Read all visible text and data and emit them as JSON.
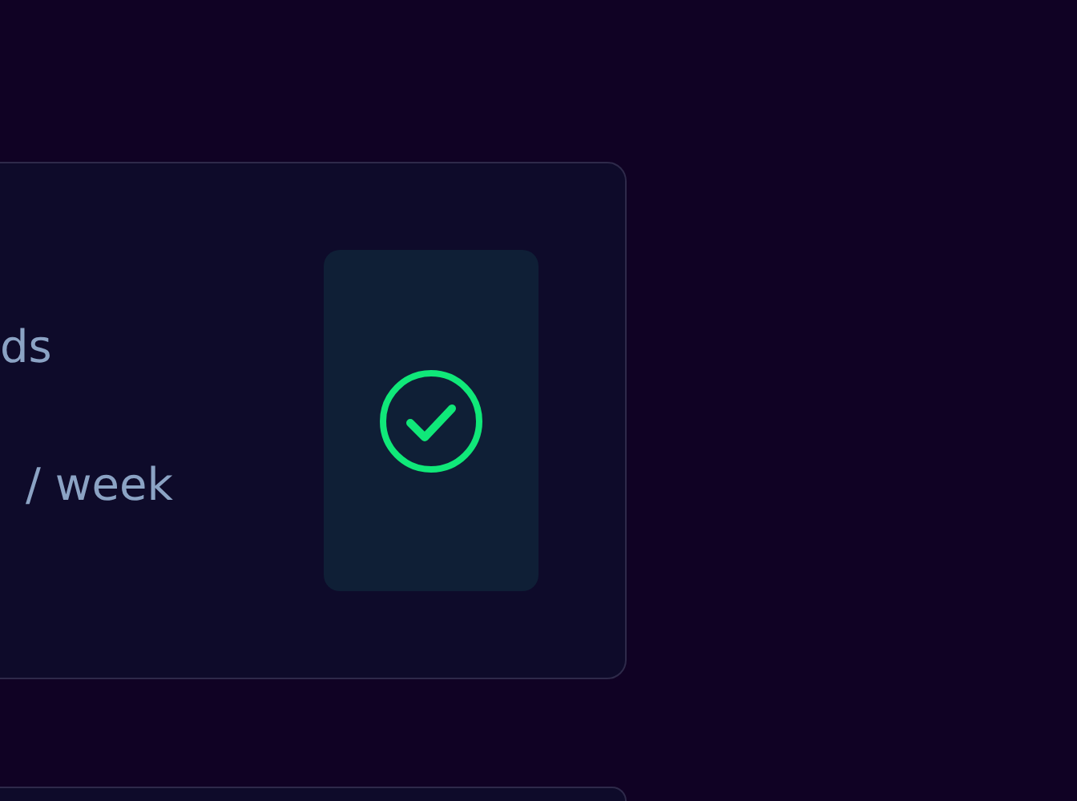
{
  "cards": [
    {
      "kind": "status",
      "line_1": "ds",
      "line_2": "/ week",
      "done": true
    },
    {
      "kind": "blank"
    }
  ]
}
